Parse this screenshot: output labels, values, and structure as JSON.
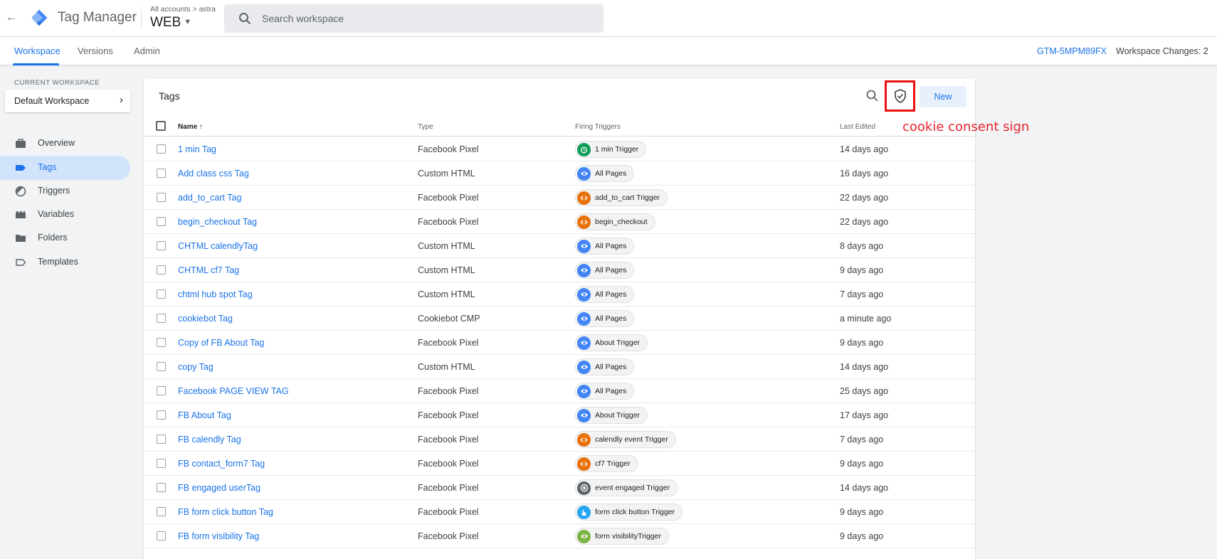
{
  "header": {
    "app_title": "Tag Manager",
    "breadcrumb": "All accounts > astra",
    "container": "WEB",
    "search_placeholder": "Search workspace"
  },
  "nav": {
    "tabs": [
      "Workspace",
      "Versions",
      "Admin"
    ],
    "active_tab": "Workspace",
    "container_id": "GTM-5MPM89FX",
    "workspace_changes": "Workspace Changes: 2"
  },
  "sidebar": {
    "current_workspace_label": "CURRENT WORKSPACE",
    "workspace_name": "Default Workspace",
    "items": [
      {
        "label": "Overview",
        "icon": "briefcase-icon"
      },
      {
        "label": "Tags",
        "icon": "tag-icon",
        "active": true
      },
      {
        "label": "Triggers",
        "icon": "trigger-icon"
      },
      {
        "label": "Variables",
        "icon": "variables-icon"
      },
      {
        "label": "Folders",
        "icon": "folder-icon"
      },
      {
        "label": "Templates",
        "icon": "template-icon"
      }
    ]
  },
  "tags_panel": {
    "title": "Tags",
    "new_button": "New",
    "columns": {
      "name": "Name",
      "type": "Type",
      "firing_triggers": "Firing Triggers",
      "last_edited": "Last Edited"
    },
    "rows": [
      {
        "name": "1 min Tag",
        "type": "Facebook Pixel",
        "trigger": "1 min Trigger",
        "trigger_kind": "timer",
        "edited": "14 days ago"
      },
      {
        "name": "Add class css Tag",
        "type": "Custom HTML",
        "trigger": "All Pages",
        "trigger_kind": "pageview",
        "edited": "16 days ago"
      },
      {
        "name": "add_to_cart Tag",
        "type": "Facebook Pixel",
        "trigger": "add_to_cart Trigger",
        "trigger_kind": "custom",
        "edited": "22 days ago"
      },
      {
        "name": "begin_checkout Tag",
        "type": "Facebook Pixel",
        "trigger": "begin_checkout",
        "trigger_kind": "custom",
        "edited": "22 days ago"
      },
      {
        "name": "CHTML calendlyTag",
        "type": "Custom HTML",
        "trigger": "All Pages",
        "trigger_kind": "pageview",
        "edited": "8 days ago"
      },
      {
        "name": "CHTML cf7 Tag",
        "type": "Custom HTML",
        "trigger": "All Pages",
        "trigger_kind": "pageview",
        "edited": "9 days ago"
      },
      {
        "name": "chtml hub spot Tag",
        "type": "Custom HTML",
        "trigger": "All Pages",
        "trigger_kind": "pageview",
        "edited": "7 days ago"
      },
      {
        "name": "cookiebot Tag",
        "type": "Cookiebot CMP",
        "trigger": "All Pages",
        "trigger_kind": "pageview",
        "edited": "a minute ago"
      },
      {
        "name": "Copy of FB About Tag",
        "type": "Facebook Pixel",
        "trigger": "About Trigger",
        "trigger_kind": "pageview",
        "edited": "9 days ago"
      },
      {
        "name": "copy Tag",
        "type": "Custom HTML",
        "trigger": "All Pages",
        "trigger_kind": "pageview",
        "edited": "14 days ago"
      },
      {
        "name": "Facebook PAGE VIEW TAG",
        "type": "Facebook Pixel",
        "trigger": "All Pages",
        "trigger_kind": "pageview",
        "edited": "25 days ago"
      },
      {
        "name": "FB About Tag",
        "type": "Facebook Pixel",
        "trigger": "About Trigger",
        "trigger_kind": "pageview",
        "edited": "17 days ago"
      },
      {
        "name": "FB calendly Tag",
        "type": "Facebook Pixel",
        "trigger": "calendly event Trigger",
        "trigger_kind": "custom",
        "edited": "7 days ago"
      },
      {
        "name": "FB contact_form7 Tag",
        "type": "Facebook Pixel",
        "trigger": "cf7 Trigger",
        "trigger_kind": "custom",
        "edited": "9 days ago"
      },
      {
        "name": "FB engaged userTag",
        "type": "Facebook Pixel",
        "trigger": "event engaged Trigger",
        "trigger_kind": "group",
        "edited": "14 days ago"
      },
      {
        "name": "FB form click button Tag",
        "type": "Facebook Pixel",
        "trigger": "form click button Trigger",
        "trigger_kind": "click",
        "edited": "9 days ago"
      },
      {
        "name": "FB form visibility Tag",
        "type": "Facebook Pixel",
        "trigger": "form visibilityTrigger",
        "trigger_kind": "visibility",
        "edited": "9 days ago"
      }
    ]
  },
  "annotation": {
    "label": "cookie consent sign"
  },
  "colors": {
    "accent": "#1a73e8",
    "timer": "#0f9d58",
    "pageview": "#4285f4",
    "custom": "#e8710a",
    "group": "#5f6368",
    "click": "#24a5f0",
    "visibility": "#7cb342",
    "annotation": "#ee1111"
  }
}
